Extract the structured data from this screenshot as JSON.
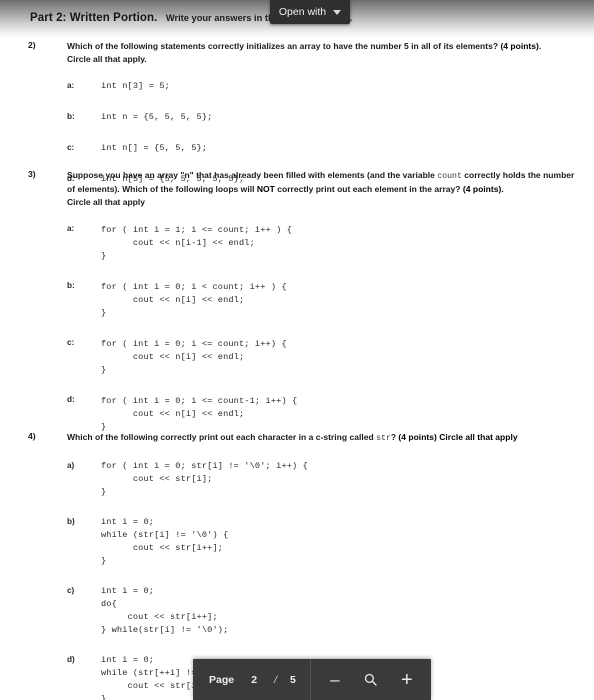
{
  "document": {
    "heading_main": "Part 2:  Written Portion.",
    "heading_sub": "Write your answers in the space provided."
  },
  "overlay": {
    "open_with_label": "Open with",
    "caret_icon": "chevron-down-icon"
  },
  "questions": [
    {
      "number": "2)",
      "prompt_pre": "Which of the following statements correctly initializes an array to have the number 5 in all of its elements? ",
      "prompt_strong": "(4 points)",
      "prompt_post": ".",
      "subline": "Circle all that apply.",
      "options": [
        {
          "letter": "a:",
          "code": "int n[3] = 5;"
        },
        {
          "letter": "b:",
          "code": "int n = {5, 5, 5, 5};"
        },
        {
          "letter": "c:",
          "code": "int n[] = {5, 5, 5};"
        },
        {
          "letter": "d:",
          "code": "int n[5] = {5, 5, 5, 5, 5};"
        }
      ]
    },
    {
      "number": "3)",
      "prompt_pre": "Suppose you have an array \"n\" that has already been filled with elements (and the variable ",
      "prompt_mono": "count",
      "prompt_mid": " correctly holds the number of elements).  Which of the following loops will ",
      "prompt_not": "NOT",
      "prompt_mid2": " correctly print out each element in the array? ",
      "prompt_strong": "(4 points)",
      "prompt_post": ".",
      "subline": "Circle all that apply",
      "options": [
        {
          "letter": "a:",
          "code": "for ( int i = 1; i <= count; i++ ) {\n      cout << n[i-1] << endl;\n}"
        },
        {
          "letter": "b:",
          "code": "for ( int i = 0; i < count; i++ ) {\n      cout << n[i] << endl;\n}"
        },
        {
          "letter": "c:",
          "code": "for ( int i = 0; i <= count; i++) {\n      cout << n[i] << endl;\n}"
        },
        {
          "letter": "d:",
          "code": "for ( int i = 0; i <= count-1; i++) {\n      cout << n[i] << endl;\n}"
        }
      ]
    },
    {
      "number": "4)",
      "prompt_pre": "Which of the following correctly print out each character in a c-string called ",
      "prompt_mono": "str",
      "prompt_mid": "? ",
      "prompt_strong": "(4 points)",
      "prompt_post": "  Circle all that apply",
      "subline": "",
      "options": [
        {
          "letter": "a)",
          "code": "for ( int i = 0; str[i] != '\\0'; i++) {\n      cout << str[i];\n}"
        },
        {
          "letter": "b)",
          "code": "int i = 0;\nwhile (str[i] != '\\0') {\n      cout << str[i++];\n}"
        },
        {
          "letter": "c)",
          "code": "int i = 0;\ndo{\n     cout << str[i++];\n} while(str[i] != '\\0');"
        },
        {
          "letter": "d)",
          "code": "int i = 0;\nwhile (str[++i] != '\\0')\n     cout << str[i];\n}"
        }
      ]
    }
  ],
  "toolbar": {
    "page_label": "Page",
    "page_current": "2",
    "page_separator": "/",
    "page_total": "5",
    "zoom_out_label": "–",
    "zoom_in_label": "+",
    "magnifier_icon": "magnifier-icon",
    "background_color": "#3a3a3a"
  }
}
